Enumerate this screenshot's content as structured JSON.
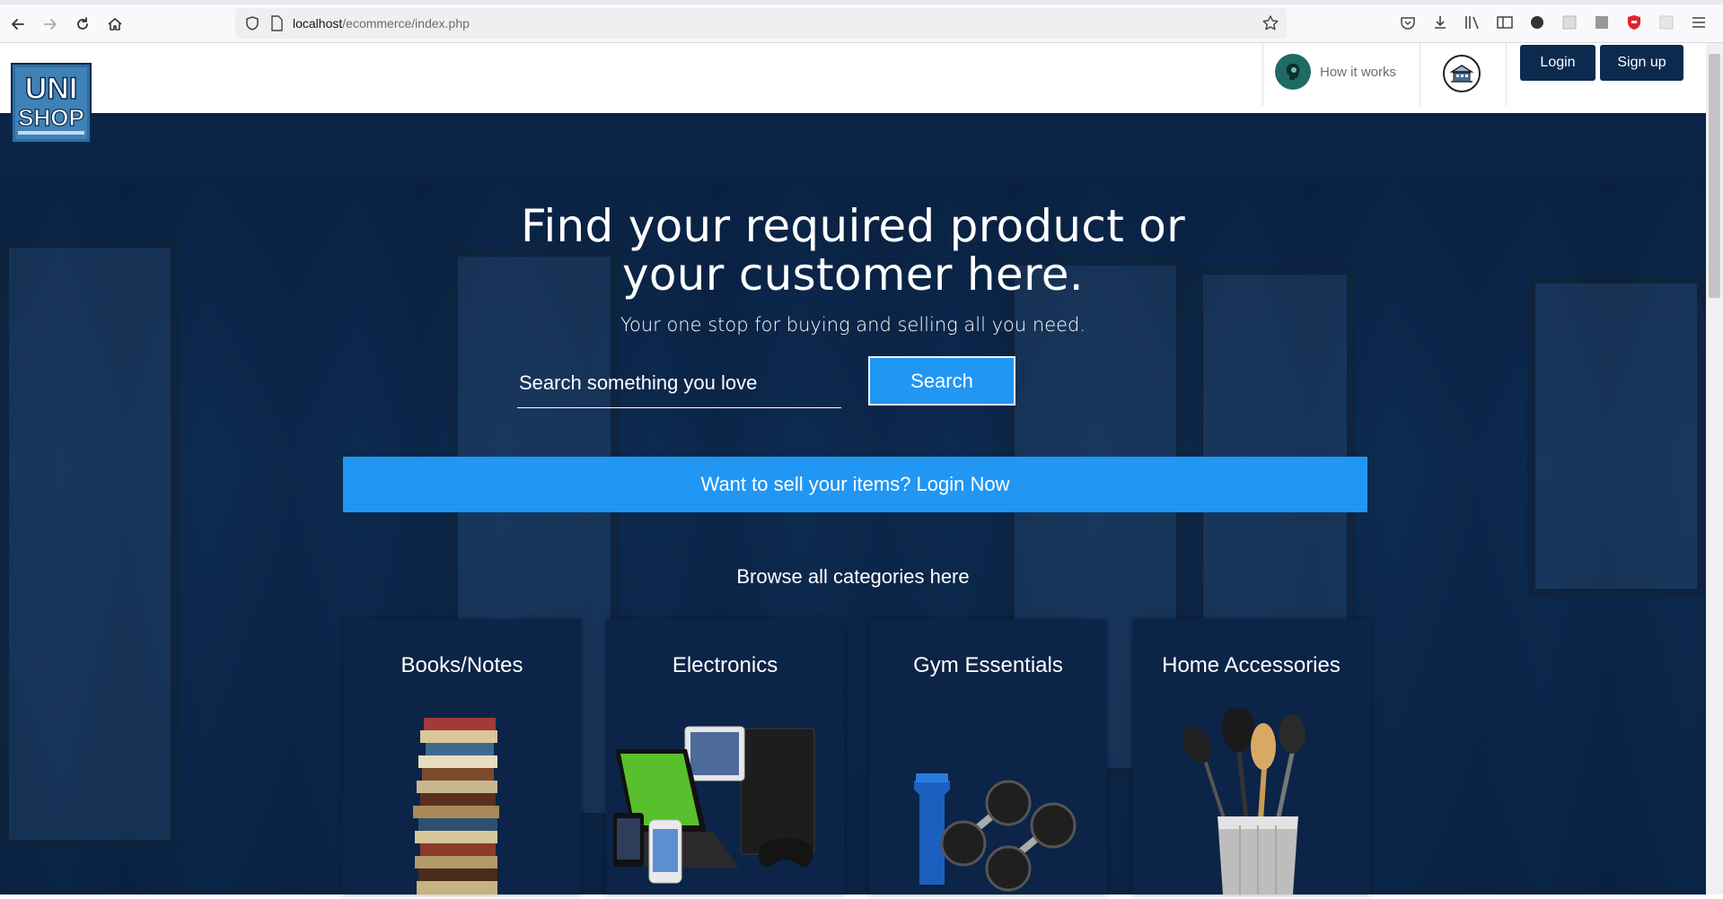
{
  "browser": {
    "url_host": "localhost",
    "url_path": "/ecommerce/index.php"
  },
  "logo": {
    "line1": "UNI",
    "line2": "SHOP"
  },
  "header": {
    "how_it_works": "How it works",
    "login_label": "Login",
    "signup_label": "Sign up"
  },
  "hero": {
    "title_line1": "Find your required product or",
    "title_line2": "your customer here.",
    "subtitle": "Your one stop for buying and selling all you need.",
    "search_placeholder": "Search something you love",
    "search_button": "Search",
    "sell_cta": "Want to sell your items? Login Now",
    "browse_label": "Browse all categories here"
  },
  "categories": [
    {
      "label": "Books/Notes"
    },
    {
      "label": "Electronics"
    },
    {
      "label": "Gym Essentials"
    },
    {
      "label": "Home Accessories"
    }
  ],
  "colors": {
    "brand_dark": "#0b2a4e",
    "accent_blue": "#2196f3",
    "hero_overlay": "#0a2447"
  }
}
